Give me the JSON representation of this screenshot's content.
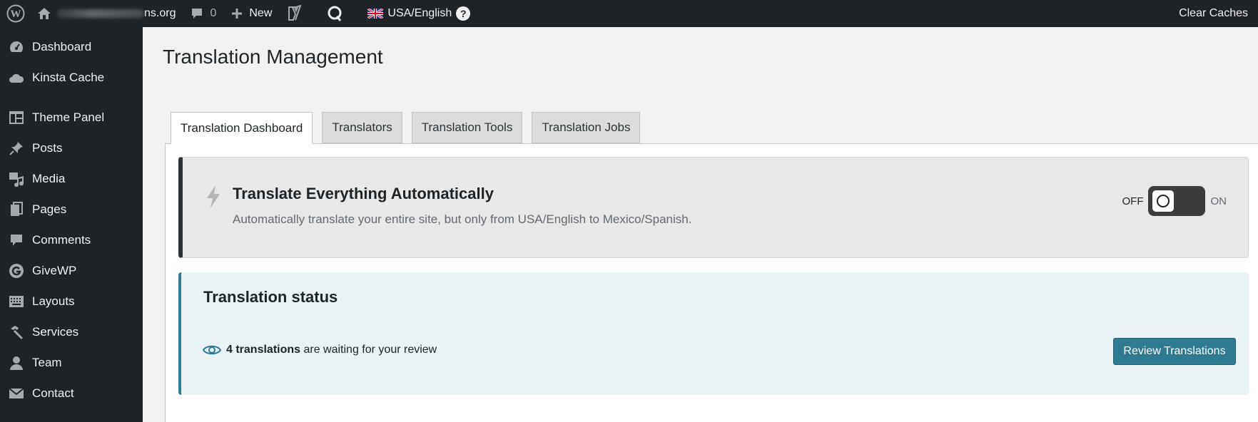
{
  "adminbar": {
    "site_name_visible": "ns.org",
    "comments_count": "0",
    "new_label": "New",
    "language_label": "USA/English",
    "help_label": "?",
    "clear_caches_label": "Clear Caches"
  },
  "sidebar": {
    "items": [
      {
        "label": "Dashboard",
        "icon": "dashboard-icon"
      },
      {
        "label": "Kinsta Cache",
        "icon": "cloud-icon"
      },
      {
        "label": "Theme Panel",
        "icon": "theme-panel-icon"
      },
      {
        "label": "Posts",
        "icon": "pin-icon"
      },
      {
        "label": "Media",
        "icon": "media-icon"
      },
      {
        "label": "Pages",
        "icon": "pages-icon"
      },
      {
        "label": "Comments",
        "icon": "comment-icon"
      },
      {
        "label": "GiveWP",
        "icon": "givewp-icon"
      },
      {
        "label": "Layouts",
        "icon": "keyboard-icon"
      },
      {
        "label": "Services",
        "icon": "hammer-icon"
      },
      {
        "label": "Team",
        "icon": "user-icon"
      },
      {
        "label": "Contact",
        "icon": "mail-icon"
      }
    ]
  },
  "page": {
    "title": "Translation Management"
  },
  "tabs": [
    {
      "label": "Translation Dashboard",
      "active": true
    },
    {
      "label": "Translators",
      "active": false
    },
    {
      "label": "Translation Tools",
      "active": false
    },
    {
      "label": "Translation Jobs",
      "active": false
    }
  ],
  "auto_translate": {
    "title": "Translate Everything Automatically",
    "description": "Automatically translate your entire site, but only from USA/English to Mexico/Spanish.",
    "off_label": "OFF",
    "on_label": "ON",
    "state": "off"
  },
  "status": {
    "title": "Translation status",
    "count_text": "4 translations",
    "rest_text": " are waiting for your review",
    "review_button": "Review Translations"
  },
  "colors": {
    "adminbar_bg": "#1d2327",
    "accent": "#2e7b92",
    "status_bg": "#e9f2f4"
  }
}
